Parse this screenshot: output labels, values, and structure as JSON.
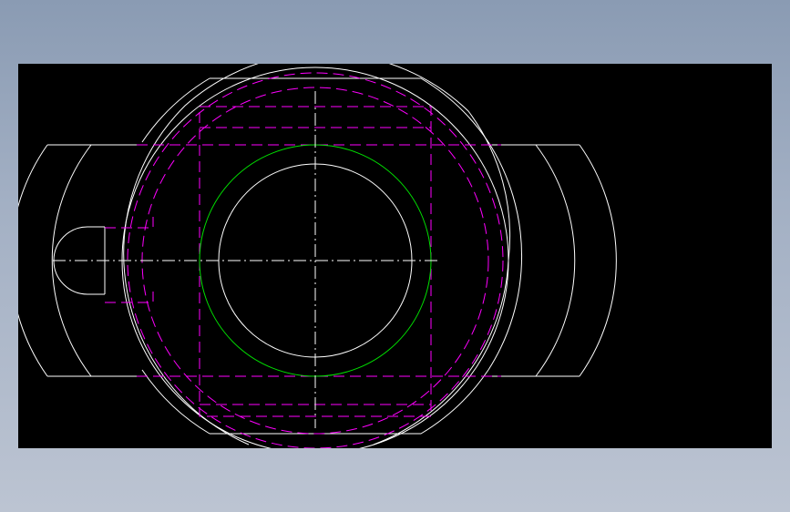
{
  "drawing": {
    "background_color": "#000000",
    "line_colors": {
      "outline": "#ffffff",
      "bore": "#00e000",
      "hidden": "#ff00ff",
      "centerline": "#ffffff"
    }
  }
}
